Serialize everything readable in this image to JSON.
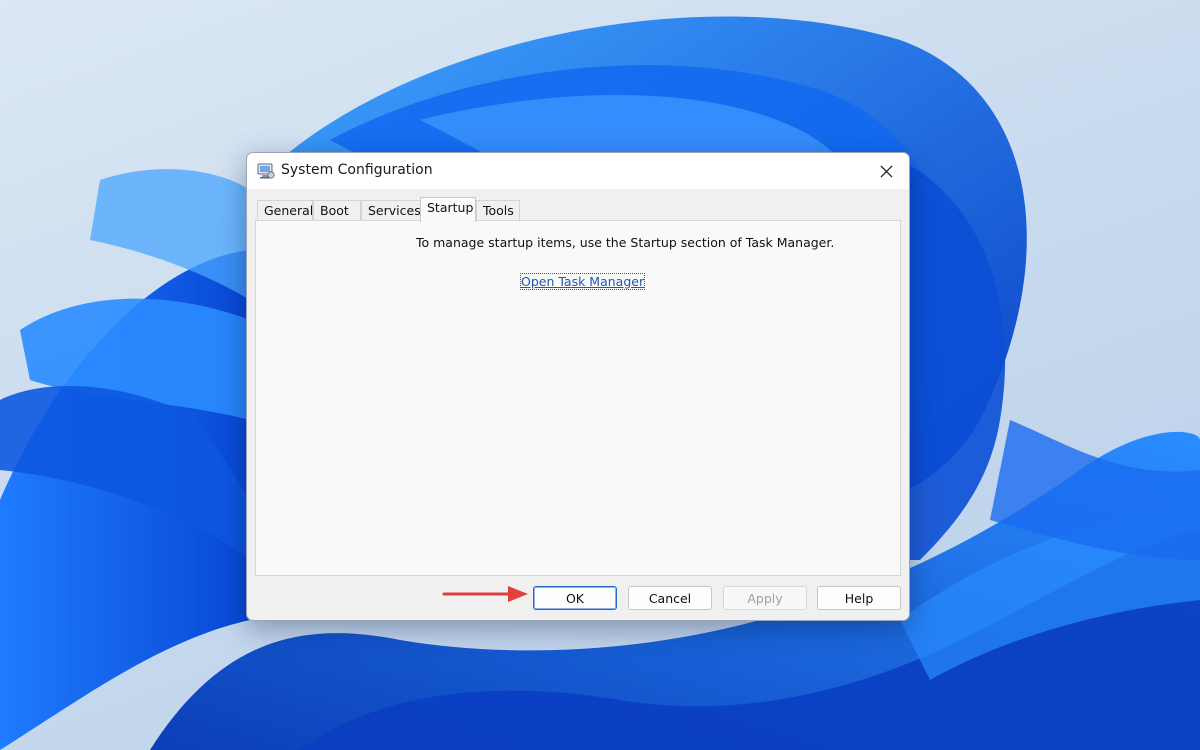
{
  "dialog": {
    "title": "System Configuration",
    "tabs": [
      {
        "label": "General",
        "active": false
      },
      {
        "label": "Boot",
        "active": false
      },
      {
        "label": "Services",
        "active": false
      },
      {
        "label": "Startup",
        "active": true
      },
      {
        "label": "Tools",
        "active": false
      }
    ],
    "startup": {
      "message": "To manage startup items, use the Startup section of Task Manager.",
      "link_label": "Open Task Manager"
    },
    "buttons": {
      "ok": "OK",
      "cancel": "Cancel",
      "apply": "Apply",
      "help": "Help"
    }
  },
  "icons": {
    "app": "system-configuration-icon",
    "close": "close-icon",
    "annotation": "red-arrow-icon"
  },
  "colors": {
    "link": "#1f5aa8",
    "default_button_border": "#2a6cc4",
    "annotation_arrow": "#e0413b",
    "wallpaper_blue": "#0b5bd8"
  }
}
